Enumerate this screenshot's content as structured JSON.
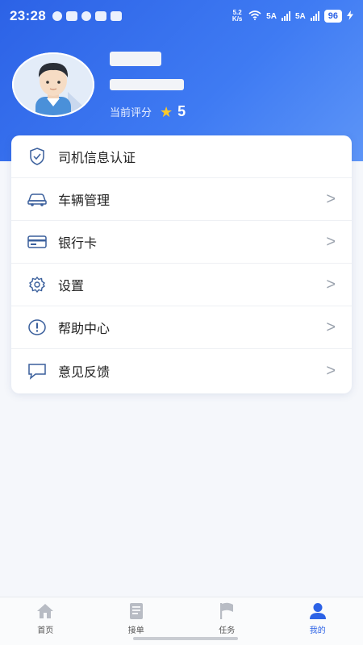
{
  "status_bar": {
    "time": "23:28",
    "speed": "5.2 K/s",
    "network_1": "5A",
    "network_2": "5A",
    "battery": "96"
  },
  "profile": {
    "rating_label": "当前评分",
    "rating_value": "5"
  },
  "menu": {
    "items": [
      {
        "label": "司机信息认证",
        "icon": "shield-check-icon",
        "chevron": false
      },
      {
        "label": "车辆管理",
        "icon": "car-icon",
        "chevron": true
      },
      {
        "label": "银行卡",
        "icon": "bank-card-icon",
        "chevron": true
      },
      {
        "label": "设置",
        "icon": "gear-icon",
        "chevron": true
      },
      {
        "label": "帮助中心",
        "icon": "help-icon",
        "chevron": true
      },
      {
        "label": "意见反馈",
        "icon": "feedback-icon",
        "chevron": true
      }
    ],
    "chevron_glyph": ">"
  },
  "tab_bar": {
    "tabs": [
      {
        "label": "首页",
        "icon": "home-icon",
        "active": false
      },
      {
        "label": "接单",
        "icon": "order-icon",
        "active": false
      },
      {
        "label": "任务",
        "icon": "flag-icon",
        "active": false
      },
      {
        "label": "我的",
        "icon": "user-icon",
        "active": true
      }
    ]
  },
  "colors": {
    "accent": "#2c62e6",
    "icon_stroke": "#3a5f9c",
    "star": "#ffc928"
  }
}
